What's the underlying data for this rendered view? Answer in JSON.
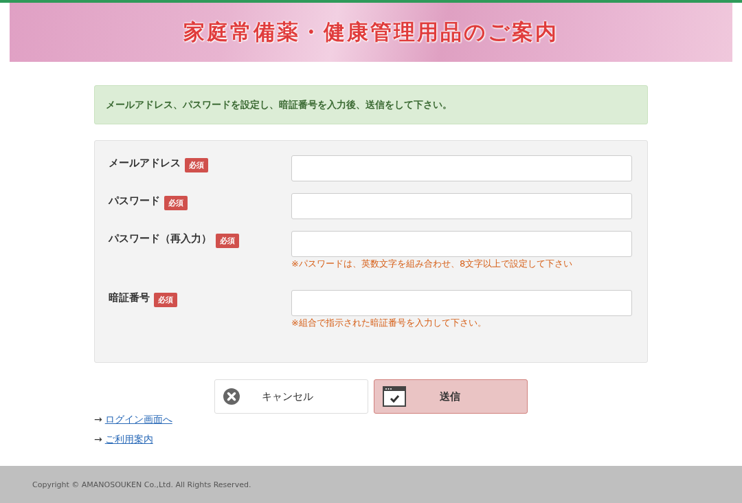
{
  "banner": {
    "title": "家庭常備薬・健康管理用品のご案内"
  },
  "alert": "メールアドレス、パスワードを設定し、暗証番号を入力後、送信をして下さい。",
  "fields": [
    {
      "label": "メールアドレス",
      "badge": "必須"
    },
    {
      "label": "パスワード",
      "badge": "必須"
    },
    {
      "label": "パスワード（再入力）",
      "badge": "必須",
      "hint": "※パスワードは、英数文字を組み合わせ、8文字以上で設定して下さい"
    },
    {
      "label": "暗証番号",
      "badge": "必須",
      "hint": "※組合で指示された暗証番号を入力して下さい。"
    }
  ],
  "buttons": [
    {
      "kind": "cancel",
      "label": "キャンセル"
    },
    {
      "kind": "submit",
      "label": "送信"
    }
  ],
  "links": [
    {
      "arrow": "→",
      "label": "ログイン画面へ"
    },
    {
      "arrow": "→",
      "label": "ご利用案内"
    }
  ],
  "footer": "Copyright © AMANOSOUKEN Co.,Ltd. All Rights Reserved."
}
